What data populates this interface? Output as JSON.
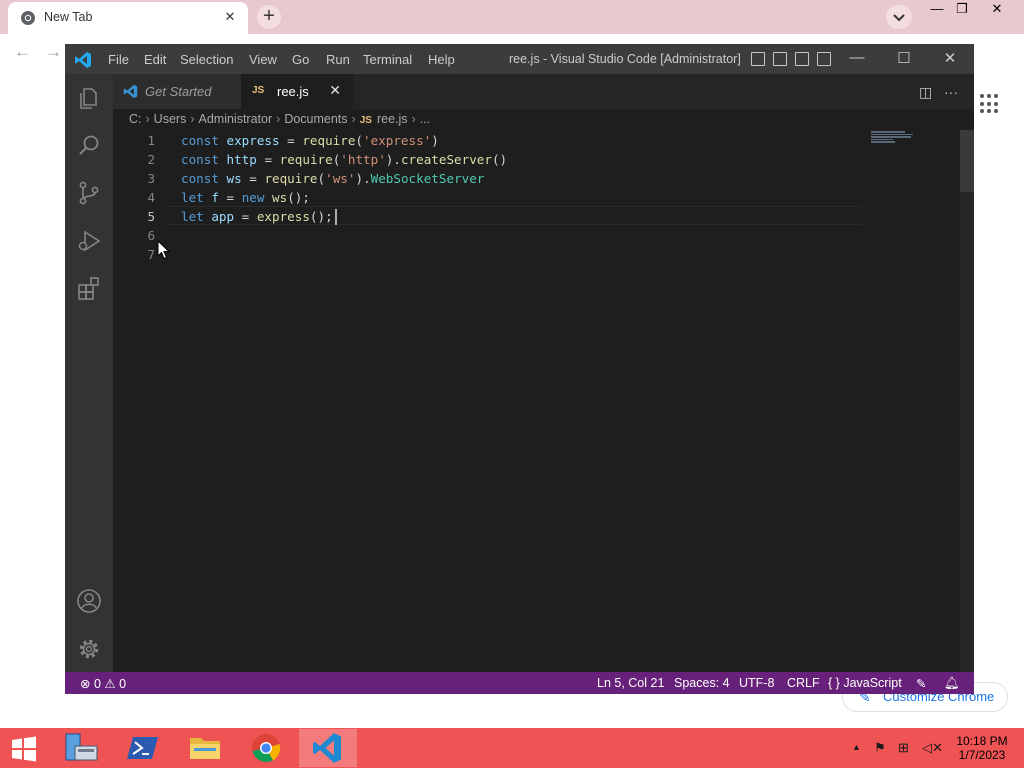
{
  "chrome": {
    "tab_title": "New Tab",
    "tab_close": "✕",
    "new_tab": "+",
    "tab_search_icon": "chevron-down-icon",
    "window_controls": [
      "—",
      "❐",
      "✕"
    ],
    "customize_label": "Customize Chrome"
  },
  "vscode": {
    "menu": [
      "File",
      "Edit",
      "Selection",
      "View",
      "Go",
      "Run",
      "Terminal",
      "Help"
    ],
    "window_title": "ree.js - Visual Studio Code [Administrator]",
    "title_controls": [
      "—",
      "☐",
      "✕"
    ],
    "tabs": [
      {
        "label": "Get Started"
      },
      {
        "label": "ree.js",
        "badge": "JS",
        "close": "✕"
      }
    ],
    "breadcrumb": {
      "parts": [
        "C:",
        "Users",
        "Administrator",
        "Documents",
        "ree.js",
        "..."
      ],
      "badge": "JS"
    },
    "line_numbers": [
      "1",
      "2",
      "3",
      "4",
      "5",
      "6",
      "7"
    ],
    "code": [
      [
        {
          "t": "const",
          "c": "kw"
        },
        {
          "t": " ",
          "c": "pun"
        },
        {
          "t": "express",
          "c": "id"
        },
        {
          "t": " = ",
          "c": "pun"
        },
        {
          "t": "require",
          "c": "fn"
        },
        {
          "t": "(",
          "c": "pun"
        },
        {
          "t": "'express'",
          "c": "str"
        },
        {
          "t": ")",
          "c": "pun"
        }
      ],
      [
        {
          "t": "const",
          "c": "kw"
        },
        {
          "t": " ",
          "c": "pun"
        },
        {
          "t": "http",
          "c": "id"
        },
        {
          "t": " = ",
          "c": "pun"
        },
        {
          "t": "require",
          "c": "fn"
        },
        {
          "t": "(",
          "c": "pun"
        },
        {
          "t": "'http'",
          "c": "str"
        },
        {
          "t": ").",
          "c": "pun"
        },
        {
          "t": "createServer",
          "c": "fn"
        },
        {
          "t": "()",
          "c": "pun"
        }
      ],
      [
        {
          "t": "const",
          "c": "kw"
        },
        {
          "t": " ",
          "c": "pun"
        },
        {
          "t": "ws",
          "c": "id"
        },
        {
          "t": " = ",
          "c": "pun"
        },
        {
          "t": "require",
          "c": "fn"
        },
        {
          "t": "(",
          "c": "pun"
        },
        {
          "t": "'ws'",
          "c": "str"
        },
        {
          "t": ").",
          "c": "pun"
        },
        {
          "t": "WebSocketServer",
          "c": "cls"
        }
      ],
      [
        {
          "t": "let",
          "c": "kw"
        },
        {
          "t": " ",
          "c": "pun"
        },
        {
          "t": "f",
          "c": "id"
        },
        {
          "t": " = ",
          "c": "pun"
        },
        {
          "t": "new",
          "c": "kw"
        },
        {
          "t": " ",
          "c": "pun"
        },
        {
          "t": "ws",
          "c": "fn"
        },
        {
          "t": "();",
          "c": "pun"
        }
      ],
      [
        {
          "t": "let",
          "c": "kw"
        },
        {
          "t": " ",
          "c": "pun"
        },
        {
          "t": "app",
          "c": "id"
        },
        {
          "t": " = ",
          "c": "pun"
        },
        {
          "t": "express",
          "c": "fn"
        },
        {
          "t": "();",
          "c": "pun"
        }
      ],
      [],
      []
    ],
    "active_line": "5",
    "statusbar": {
      "errors": "0",
      "warnings": "0",
      "position": "Ln 5, Col 21",
      "spaces": "Spaces: 4",
      "encoding": "UTF-8",
      "eol": "CRLF",
      "language_icon": "{ }",
      "language": "JavaScript"
    },
    "colors": {
      "statusbar": "#68217a",
      "keyword": "#569cd6",
      "identifier": "#9cdcfe",
      "function": "#dcdcaa",
      "string": "#ce9178",
      "class": "#4ec9b0"
    }
  },
  "taskbar": {
    "time": "10:18 PM",
    "date": "1/7/2023",
    "tray_up": "▲",
    "apps": [
      "server-manager",
      "powershell",
      "file-explorer",
      "chrome",
      "vscode"
    ]
  }
}
